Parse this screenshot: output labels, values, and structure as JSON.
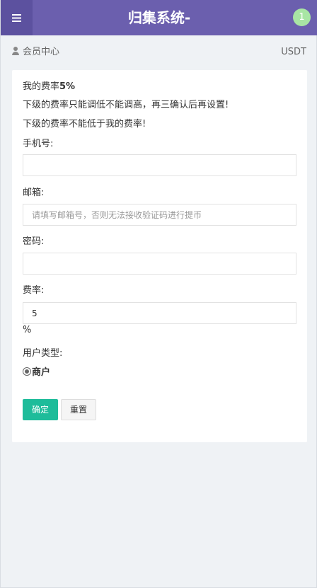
{
  "header": {
    "title": "归集系统-",
    "badge": "1",
    "menu_icon": "hamburger-icon"
  },
  "breadcrumb": {
    "icon": "user-icon",
    "label": "会员中心",
    "right_text": "USDT"
  },
  "notice": {
    "rate_prefix": "我的费率",
    "rate_value": "5%",
    "line2": "下级的费率只能调低不能调高，再三确认后再设置!",
    "line3": "下级的费率不能低于我的费率!"
  },
  "form": {
    "phone_label": "手机号:",
    "phone_value": "",
    "email_label": "邮箱:",
    "email_placeholder": "请填写邮箱号，否则无法接收验证码进行提币",
    "password_label": "密码:",
    "password_value": "",
    "rate_label": "费率:",
    "rate_value": "5",
    "rate_unit": "%",
    "user_type_label": "用户类型:",
    "user_type_option": "商户",
    "confirm_label": "确定",
    "reset_label": "重置"
  },
  "colors": {
    "header": "#6b5fae",
    "accent": "#1ebc9a",
    "badge": "#a8e5a4"
  }
}
